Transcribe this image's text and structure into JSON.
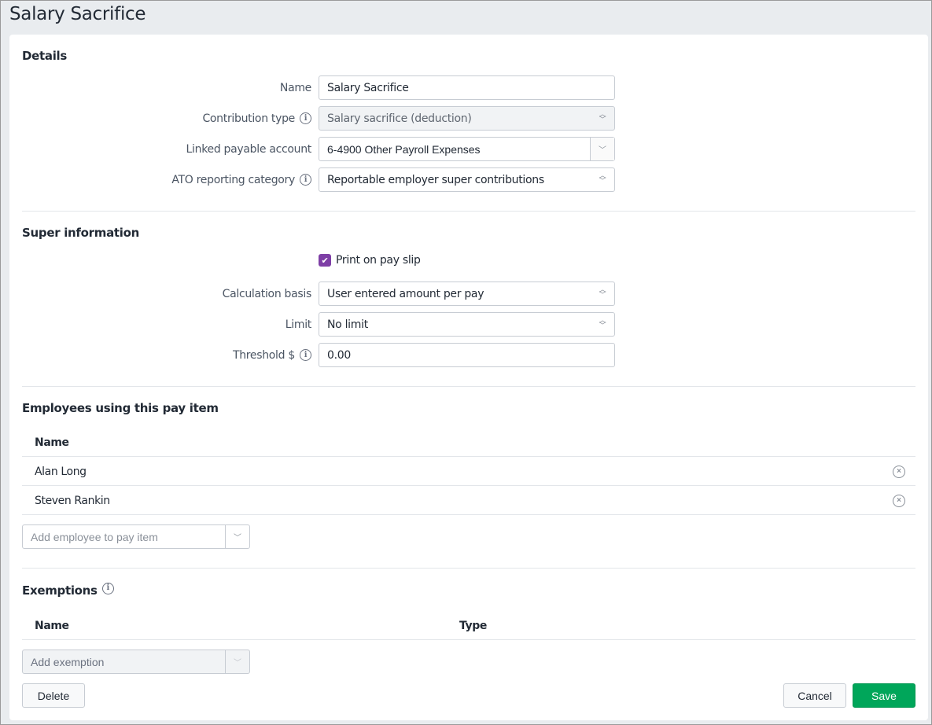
{
  "page": {
    "title": "Salary Sacrifice"
  },
  "details": {
    "heading": "Details",
    "name": {
      "label": "Name",
      "value": "Salary Sacrifice"
    },
    "contribution_type": {
      "label": "Contribution type",
      "value": "Salary sacrifice (deduction)",
      "disabled": true
    },
    "linked_payable_account": {
      "label": "Linked payable account",
      "value": "6-4900 Other Payroll Expenses"
    },
    "ato_reporting_category": {
      "label": "ATO reporting category",
      "value": "Reportable employer super contributions"
    }
  },
  "super_information": {
    "heading": "Super information",
    "print_on_pay_slip": {
      "label": "Print on pay slip",
      "checked": true
    },
    "calculation_basis": {
      "label": "Calculation basis",
      "value": "User entered amount per pay"
    },
    "limit": {
      "label": "Limit",
      "value": "No limit"
    },
    "threshold": {
      "label": "Threshold $",
      "value": "0.00"
    }
  },
  "employees": {
    "heading": "Employees using this pay item",
    "columns": [
      "Name"
    ],
    "rows": [
      {
        "name": "Alan Long"
      },
      {
        "name": "Steven Rankin"
      }
    ],
    "add_placeholder": "Add employee to pay item"
  },
  "exemptions": {
    "heading": "Exemptions",
    "columns": [
      "Name",
      "Type"
    ],
    "rows": [],
    "add_placeholder": "Add exemption"
  },
  "actions": {
    "delete_label": "Delete",
    "cancel_label": "Cancel",
    "save_label": "Save"
  },
  "colors": {
    "accent_checkbox": "#7e3fa6",
    "save_button": "#00a65a",
    "page_background": "#e9ecef"
  }
}
